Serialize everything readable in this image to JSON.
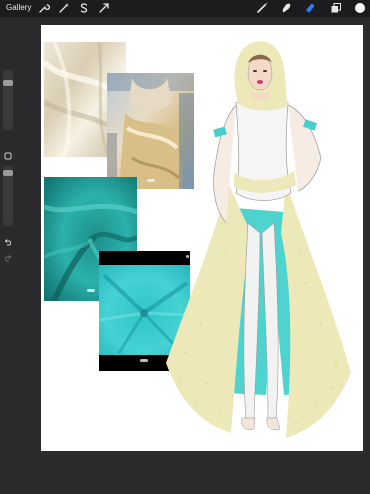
{
  "topbar": {
    "gallery_label": "Gallery",
    "tools_left": [
      "wrench-icon",
      "magic-wand-icon",
      "selection-s-icon",
      "transform-arrow-icon"
    ],
    "tools_right": [
      "brush-icon",
      "smudge-icon",
      "eraser-icon",
      "layers-icon",
      "color-circle"
    ]
  },
  "colors": {
    "active_tool": "#2f7cf6",
    "color_chip": "#ffffff",
    "toolbar_bg": "#1c1c1e",
    "workspace_bg": "#2b2b2d"
  },
  "sidebar": {
    "undo_icon": "undo-icon",
    "redo_icon": "redo-icon",
    "square_icon": "modify-square-icon"
  }
}
